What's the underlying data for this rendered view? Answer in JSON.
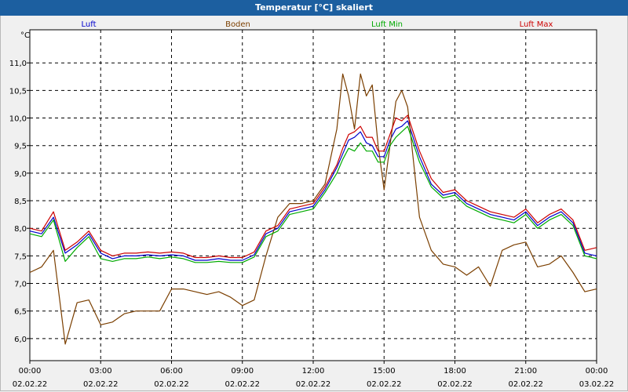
{
  "window": {
    "title": "Temperatur [°C] skaliert"
  },
  "chart_data": {
    "type": "line",
    "title": "Temperatur [°C] skaliert",
    "ylabel": "°C",
    "xlabel": "",
    "xlim": [
      "02.02.22 00:00",
      "03.02.22 00:00"
    ],
    "ylim": [
      5.6,
      11.6
    ],
    "yticks": [
      "6,0",
      "6,5",
      "7,0",
      "7,5",
      "8,0",
      "8,5",
      "9,0",
      "9,5",
      "10,0",
      "10,5",
      "11,0"
    ],
    "ytick_values": [
      6.0,
      6.5,
      7.0,
      7.5,
      8.0,
      8.5,
      9.0,
      9.5,
      10.0,
      10.5,
      11.0
    ],
    "xticks": [
      {
        "time": "00:00",
        "date": "02.02.22"
      },
      {
        "time": "03:00",
        "date": "02.02.22"
      },
      {
        "time": "06:00",
        "date": "02.02.22"
      },
      {
        "time": "09:00",
        "date": "02.02.22"
      },
      {
        "time": "12:00",
        "date": "02.02.22"
      },
      {
        "time": "15:00",
        "date": "02.02.22"
      },
      {
        "time": "18:00",
        "date": "02.02.22"
      },
      {
        "time": "21:00",
        "date": "02.02.22"
      },
      {
        "time": "00:00",
        "date": "03.02.22"
      }
    ],
    "grid": true,
    "legend_position": "top",
    "x_hours": [
      0,
      0.5,
      1,
      1.5,
      2,
      2.5,
      3,
      3.5,
      4,
      4.5,
      5,
      5.5,
      6,
      6.5,
      7,
      7.5,
      8,
      8.5,
      9,
      9.5,
      10,
      10.5,
      11,
      11.5,
      12,
      12.5,
      13,
      13.25,
      13.5,
      13.75,
      14,
      14.25,
      14.5,
      14.75,
      15,
      15.25,
      15.5,
      15.75,
      16,
      16.5,
      17,
      17.5,
      18,
      18.5,
      19,
      19.5,
      20,
      20.5,
      21,
      21.5,
      22,
      22.5,
      23,
      23.5,
      24
    ],
    "series": [
      {
        "name": "Luft",
        "color": "#0000cc",
        "values": [
          7.95,
          7.9,
          8.2,
          7.55,
          7.7,
          7.9,
          7.55,
          7.45,
          7.5,
          7.5,
          7.52,
          7.5,
          7.52,
          7.5,
          7.42,
          7.42,
          7.45,
          7.42,
          7.42,
          7.52,
          7.9,
          8.0,
          8.3,
          8.35,
          8.4,
          8.7,
          9.1,
          9.35,
          9.6,
          9.65,
          9.75,
          9.55,
          9.5,
          9.3,
          9.3,
          9.6,
          9.8,
          9.85,
          9.95,
          9.3,
          8.8,
          8.6,
          8.65,
          8.45,
          8.35,
          8.25,
          8.2,
          8.15,
          8.3,
          8.05,
          8.2,
          8.3,
          8.1,
          7.55,
          7.5
        ]
      },
      {
        "name": "Boden",
        "color": "#7b3f00",
        "values": [
          7.2,
          7.3,
          7.6,
          5.9,
          6.65,
          6.7,
          6.25,
          6.3,
          6.45,
          6.5,
          6.5,
          6.5,
          6.9,
          6.9,
          6.85,
          6.8,
          6.85,
          6.75,
          6.6,
          6.7,
          7.5,
          8.2,
          8.45,
          8.45,
          8.5,
          8.8,
          9.8,
          10.8,
          10.4,
          9.8,
          10.8,
          10.4,
          10.6,
          9.5,
          8.7,
          9.5,
          10.3,
          10.5,
          10.2,
          8.2,
          7.6,
          7.35,
          7.3,
          7.15,
          7.3,
          6.95,
          7.6,
          7.7,
          7.75,
          7.3,
          7.35,
          7.5,
          7.2,
          6.85,
          6.9
        ]
      },
      {
        "name": "Luft Min",
        "color": "#00aa00",
        "values": [
          7.9,
          7.85,
          8.15,
          7.4,
          7.65,
          7.85,
          7.45,
          7.4,
          7.45,
          7.45,
          7.48,
          7.45,
          7.48,
          7.45,
          7.38,
          7.38,
          7.4,
          7.38,
          7.38,
          7.48,
          7.85,
          7.95,
          8.25,
          8.3,
          8.35,
          8.65,
          9.0,
          9.25,
          9.45,
          9.4,
          9.55,
          9.4,
          9.4,
          9.2,
          9.2,
          9.5,
          9.65,
          9.75,
          9.85,
          9.2,
          8.75,
          8.55,
          8.6,
          8.4,
          8.3,
          8.2,
          8.15,
          8.1,
          8.25,
          8.0,
          8.15,
          8.25,
          8.05,
          7.5,
          7.45
        ]
      },
      {
        "name": "Luft Max",
        "color": "#cc0000",
        "values": [
          8.0,
          7.95,
          8.3,
          7.6,
          7.75,
          7.95,
          7.6,
          7.5,
          7.55,
          7.55,
          7.57,
          7.55,
          7.57,
          7.55,
          7.47,
          7.47,
          7.5,
          7.47,
          7.47,
          7.57,
          7.95,
          8.05,
          8.35,
          8.4,
          8.45,
          8.75,
          9.15,
          9.45,
          9.7,
          9.75,
          9.85,
          9.65,
          9.65,
          9.4,
          9.4,
          9.7,
          10.0,
          9.95,
          10.05,
          9.4,
          8.9,
          8.65,
          8.7,
          8.5,
          8.4,
          8.3,
          8.25,
          8.2,
          8.35,
          8.1,
          8.25,
          8.35,
          8.15,
          7.6,
          7.65
        ]
      }
    ]
  }
}
